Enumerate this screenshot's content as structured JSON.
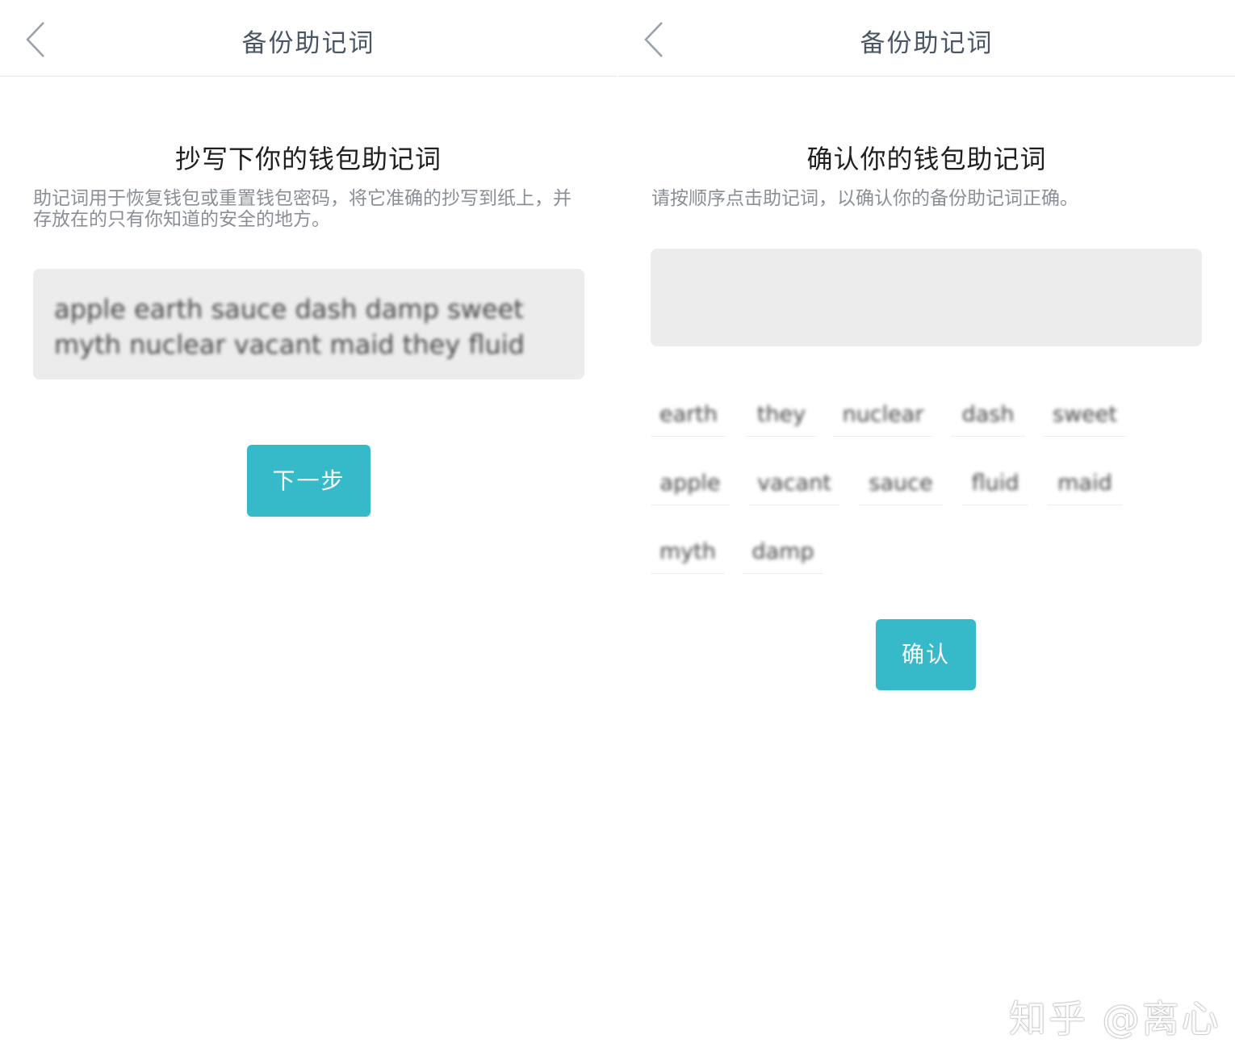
{
  "left": {
    "nav_title": "备份助记词",
    "heading": "抄写下你的钱包助记词",
    "description": "助记词用于恢复钱包或重置钱包密码，将它准确的抄写到纸上，并存放在的只有你知道的安全的地方。",
    "mnemonic": "apple earth sauce dash damp sweet myth nuclear vacant maid they fluid",
    "next_button": "下一步"
  },
  "right": {
    "nav_title": "备份助记词",
    "heading": "确认你的钱包助记词",
    "description": "请按顺序点击助记词，以确认你的备份助记词正确。",
    "words": [
      "earth",
      "they",
      "nuclear",
      "dash",
      "sweet",
      "apple",
      "vacant",
      "sauce",
      "fluid",
      "maid",
      "myth",
      "damp"
    ],
    "confirm_button": "确认"
  },
  "watermark": "知乎 @离心",
  "colors": {
    "accent": "#36b9c8",
    "box_bg": "#ececec",
    "title": "#4a5565"
  },
  "icons": {
    "back": "chevron-left-icon"
  }
}
